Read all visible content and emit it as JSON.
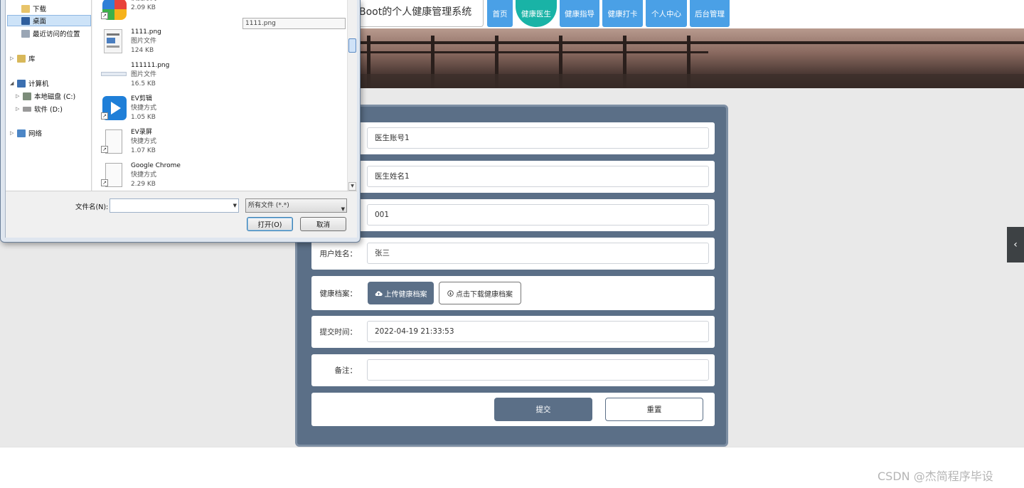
{
  "site": {
    "title": "Boot的个人健康管理系统",
    "nav": [
      {
        "label": "首页",
        "active": false
      },
      {
        "label": "健康医生",
        "active": true
      },
      {
        "label": "健康指导",
        "active": false
      },
      {
        "label": "健康打卡",
        "active": false
      },
      {
        "label": "个人中心",
        "active": false
      },
      {
        "label": "后台管理",
        "active": false
      }
    ]
  },
  "form": {
    "doctor_account": "医生账号1",
    "doctor_name": "医生姓名1",
    "user_account": "001",
    "user_name_label": "用户姓名：",
    "user_name": "张三",
    "health_file_label": "健康档案：",
    "upload_label": "上传健康档案",
    "download_label": "点击下载健康档案",
    "submit_time_label": "提交时间：",
    "submit_time": "2022-04-19 21:33:53",
    "remark_label": "备注：",
    "remark": "",
    "submit_label": "提交",
    "reset_label": "重置"
  },
  "dialog": {
    "nav": {
      "downloads": "下载",
      "desktop": "桌面",
      "recent": "最近访问的位置",
      "libraries": "库",
      "computer": "计算机",
      "drive_c": "本地磁盘 (C:)",
      "drive_d": "软件 (D:)",
      "network": "网络"
    },
    "files": [
      {
        "name": "",
        "type": "快捷方式",
        "size": "2.09 KB"
      },
      {
        "name": "1111.png",
        "type": "图片文件",
        "size": "124 KB"
      },
      {
        "name": "111111.png",
        "type": "图片文件",
        "size": "16.5 KB"
      },
      {
        "name": "EV剪辑",
        "type": "快捷方式",
        "size": "1.05 KB"
      },
      {
        "name": "EV录屏",
        "type": "快捷方式",
        "size": "1.07 KB"
      },
      {
        "name": "Google Chrome",
        "type": "快捷方式",
        "size": "2.29 KB"
      }
    ],
    "preview_name": "1111.png",
    "filename_label": "文件名(N):",
    "filename_value": "",
    "file_type": "所有文件 (*.*)",
    "open_label": "打开(O)",
    "cancel_label": "取消"
  },
  "watermark": "CSDN @杰简程序毕设",
  "colors": {
    "nav_blue": "#4aa0e6",
    "nav_active": "#19b3a6",
    "panel": "#5b6f87"
  }
}
